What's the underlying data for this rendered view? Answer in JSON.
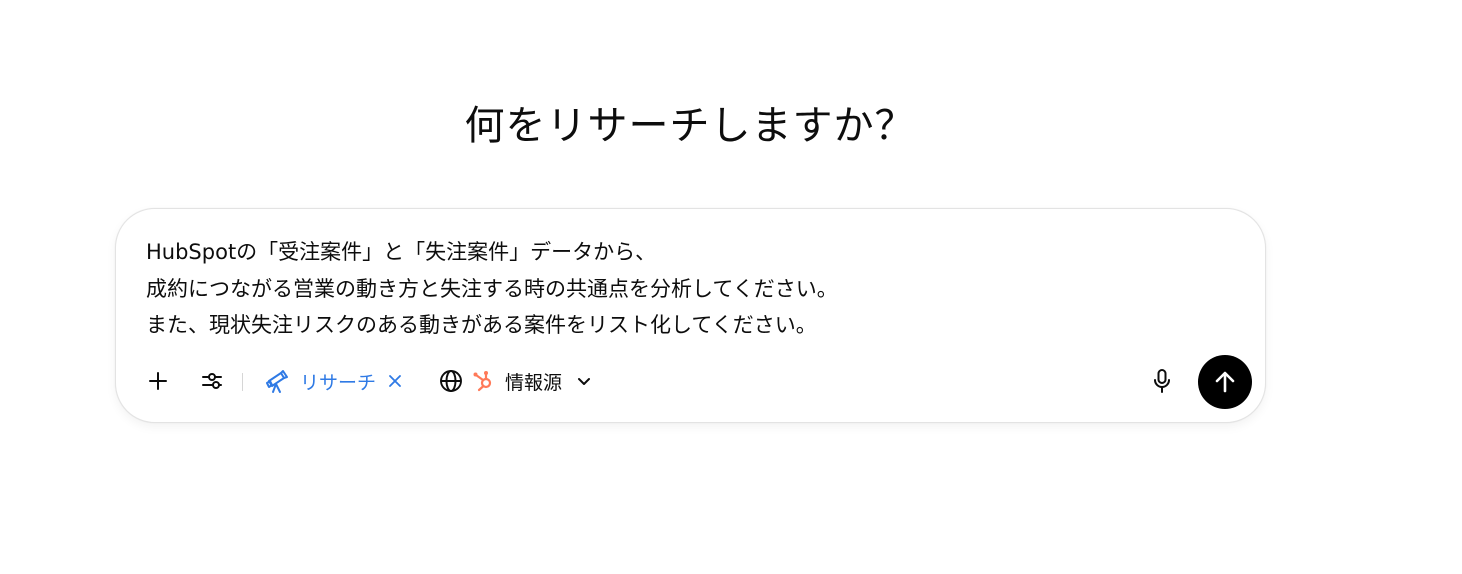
{
  "heading": "何をリサーチしますか？",
  "composer": {
    "prompt_lines": [
      "HubSpotの「受注案件」と「失注案件」データから、",
      "成約につながる営業の動き方と失注する時の共通点を分析してください。",
      "また、現状失注リスクのある動きがある案件をリスト化してください。"
    ],
    "research_chip_label": "リサーチ",
    "sources_label": "情報源"
  },
  "icons": {
    "add": "plus-icon",
    "tools": "sliders-icon",
    "research": "telescope-icon",
    "remove_chip": "close-icon",
    "web": "globe-icon",
    "hubspot": "hubspot-icon",
    "dropdown": "chevron-down-icon",
    "voice": "microphone-icon",
    "send": "arrow-up-icon"
  },
  "colors": {
    "accent_blue": "#2f7ae5",
    "hubspot_orange": "#ff7a59",
    "send_bg": "#000000",
    "text": "#0d0d0d"
  }
}
